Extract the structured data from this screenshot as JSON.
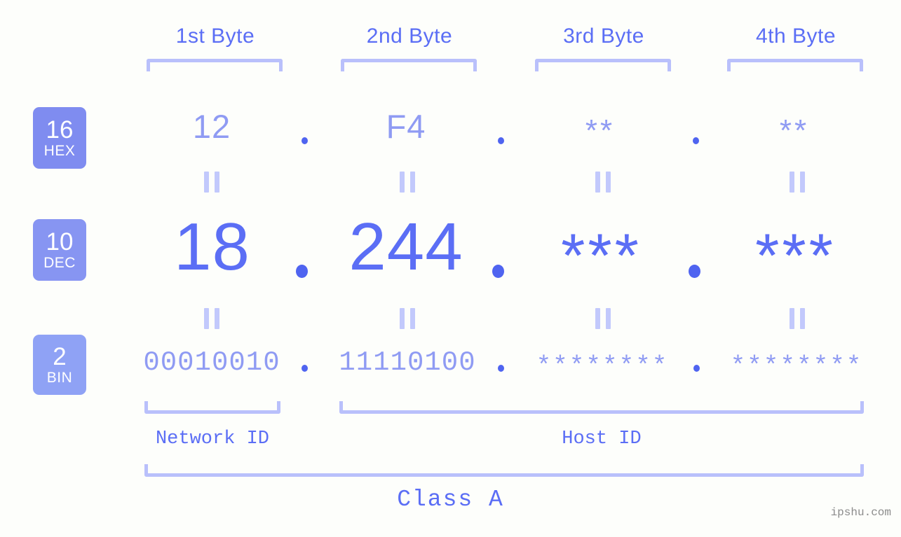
{
  "background_color": "#fdfefb",
  "accent_color": "#5b6ef5",
  "accent_light": "#8f9bf3",
  "bracket_color": "#b9c0fb",
  "byte_headers": [
    {
      "label": "1st Byte"
    },
    {
      "label": "2nd Byte"
    },
    {
      "label": "3rd Byte"
    },
    {
      "label": "4th Byte"
    }
  ],
  "bases": [
    {
      "number": "16",
      "name": "HEX",
      "badge_color": "#7f8cf0"
    },
    {
      "number": "10",
      "name": "DEC",
      "badge_color": "#8795f2"
    },
    {
      "number": "2",
      "name": "BIN",
      "badge_color": "#8fa2f5"
    }
  ],
  "rows": {
    "hex": {
      "b1": "12",
      "b2": "F4",
      "b3": "**",
      "b4": "**"
    },
    "dec": {
      "b1": "18",
      "b2": "244",
      "b3": "***",
      "b4": "***"
    },
    "bin": {
      "b1": "00010010",
      "b2": "11110100",
      "b3": "********",
      "b4": "********"
    }
  },
  "separators": {
    "dot": "."
  },
  "equals_marks": {
    "symbol": "="
  },
  "id_labels": {
    "network": "Network ID",
    "host": "Host ID"
  },
  "class_label": "Class A",
  "watermark": "ipshu.com"
}
